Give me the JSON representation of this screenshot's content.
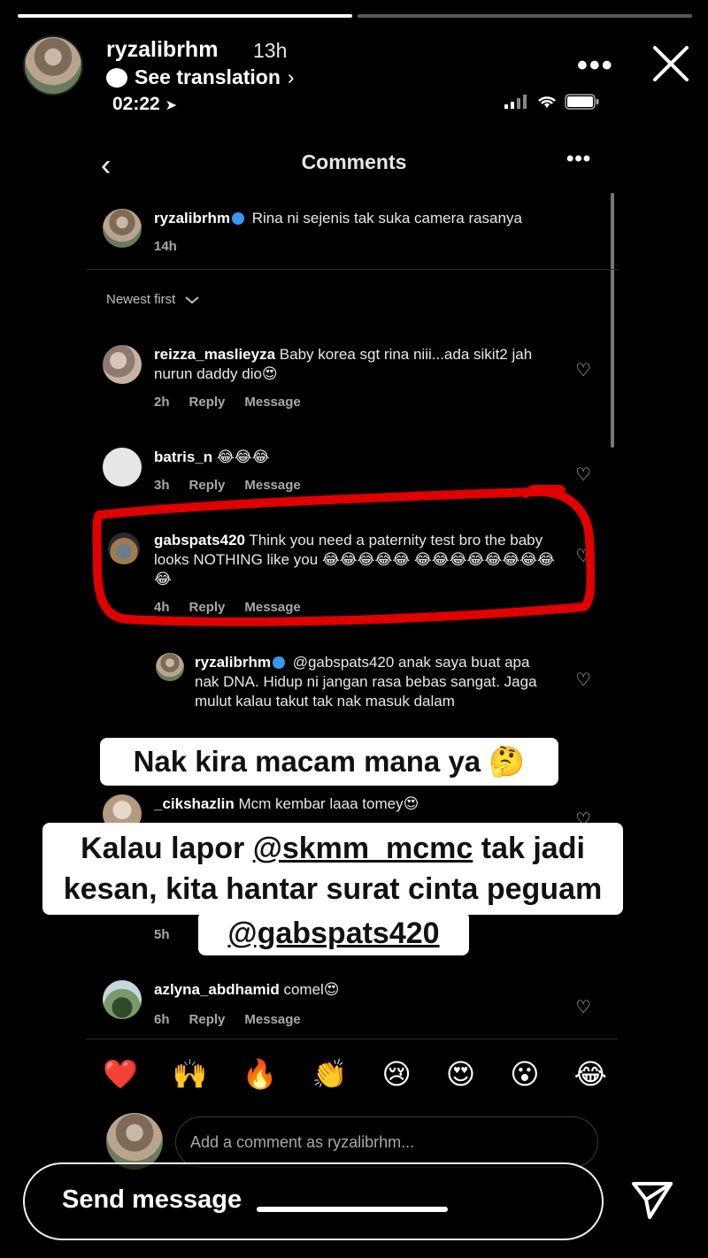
{
  "story": {
    "progress": [
      1.0,
      0.0
    ],
    "username": "ryzalibrhm",
    "time_ago": "13h",
    "see_translation": "See translation",
    "more": "•••",
    "close": "✕"
  },
  "status_bar": {
    "time": "02:22"
  },
  "panel": {
    "title": "Comments",
    "back": "‹",
    "more": "•••",
    "sort_label": "Newest first"
  },
  "caption": {
    "username": "ryzalibrhm",
    "text": "Rina ni sejenis tak suka camera rasanya",
    "time": "14h"
  },
  "comments": [
    {
      "username": "reizza_maslieyza",
      "text": "Baby korea sgt rina niii...ada sikit2 jah nurun daddy dio😍",
      "time": "2h",
      "reply": "Reply",
      "message": "Message"
    },
    {
      "username": "batris_n",
      "text": "😂😂😂",
      "time": "3h",
      "reply": "Reply",
      "message": "Message"
    },
    {
      "username": "gabspats420",
      "text": "Think you need a paternity test bro the baby looks NOTHING like you 😂😂😂😂😂 😂😂😂😂😂😂😂😂😂",
      "time": "4h",
      "reply": "Reply",
      "message": "Message"
    },
    {
      "username": "ryzalibrhm",
      "text": "@gabspats420 anak saya buat apa nak DNA. Hidup ni jangan rasa bebas sangat. Jaga mulut kalau takut tak nak masuk dalam"
    },
    {
      "username": "_cikshazlin",
      "text": "Mcm kembar laaa tomey😍",
      "time": "5h"
    },
    {
      "username": "azlyna_abdhamid",
      "text": "comel😍",
      "time": "6h",
      "reply": "Reply",
      "message": "Message"
    }
  ],
  "stickers": {
    "s1": "Nak kira macam mana ya 🤔",
    "s2_part1": "Kalau lapor ",
    "s2_mention": "@skmm_mcmc",
    "s2_part2": " tak jadi kesan, kita hantar surat cinta peguam",
    "s3": "@gabspats420"
  },
  "reactions": [
    "❤️",
    "🙌",
    "🔥",
    "👏",
    "😢",
    "😍",
    "😮",
    "😂"
  ],
  "add_comment": {
    "placeholder": "Add a comment as ryzalibrhm..."
  },
  "send": {
    "label": "Send message"
  },
  "colors": {
    "background": "#000000",
    "red_mark": "#e00000",
    "verified": "#3897f0"
  }
}
